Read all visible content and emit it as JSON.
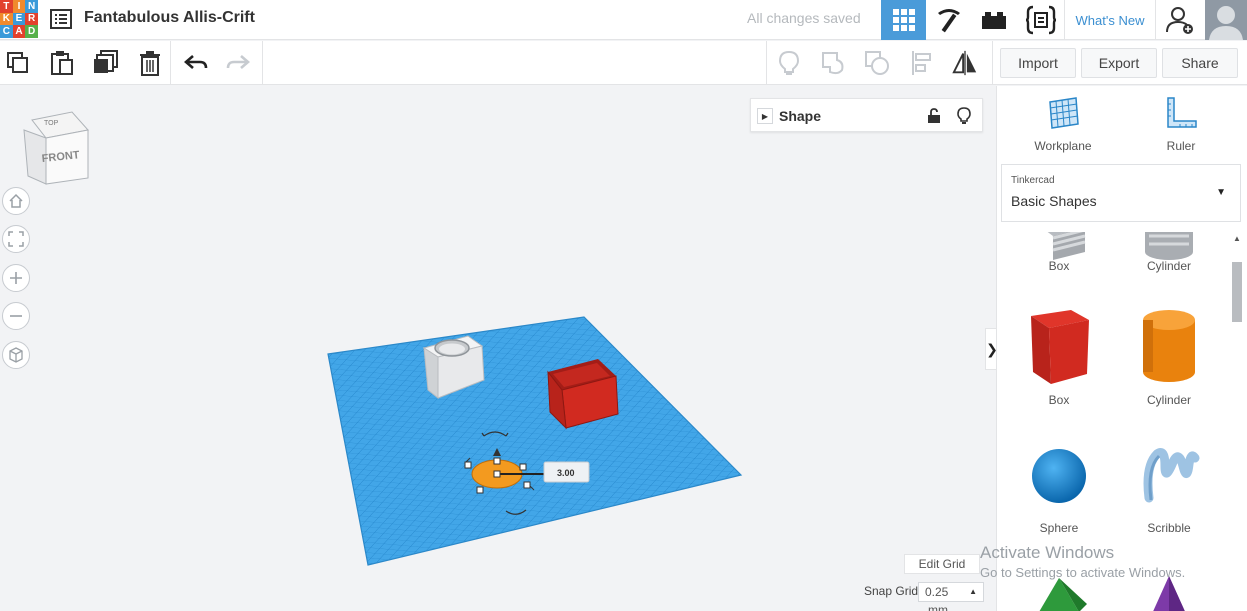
{
  "app": {
    "title": "Fantabulous Allis-Crift",
    "saved_status": "All changes saved",
    "logo_letters": [
      "T",
      "I",
      "N",
      "K",
      "E",
      "R",
      "C",
      "A",
      "D"
    ],
    "whats_new_label": "What's New",
    "accent": "#4a9bd9"
  },
  "toolbar": {
    "import_label": "Import",
    "export_label": "Export",
    "share_label": "Share"
  },
  "viewport": {
    "view_cube": {
      "top_label": "TOP",
      "front_label": "FRONT"
    },
    "shape_panel_title": "Shape",
    "dimension_value": "3.00",
    "edit_grid_label": "Edit Grid",
    "snap_grid_label": "Snap Grid",
    "snap_grid_value": "0.25",
    "snap_grid_unit": "mm"
  },
  "rightpanel": {
    "workplane_label": "Workplane",
    "ruler_label": "Ruler",
    "library_category": "Tinkercad",
    "library_name": "Basic Shapes",
    "shapes": [
      {
        "label": "Box"
      },
      {
        "label": "Cylinder"
      },
      {
        "label": "Box"
      },
      {
        "label": "Cylinder"
      },
      {
        "label": "Sphere"
      },
      {
        "label": "Scribble"
      }
    ]
  },
  "watermark": {
    "line1": "Activate Windows",
    "line2": "Go to Settings to activate Windows."
  }
}
